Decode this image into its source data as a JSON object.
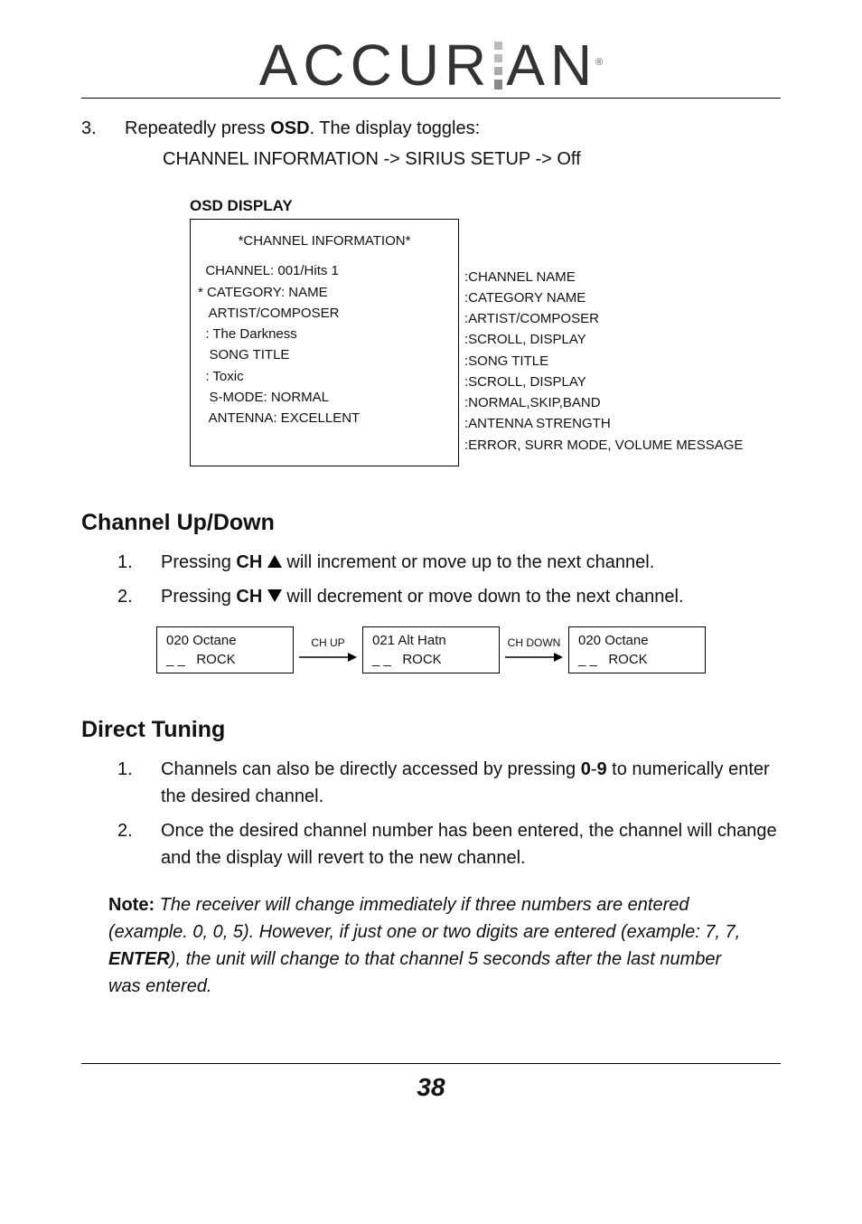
{
  "logo_text_1": "ACCUR",
  "logo_text_2": "AN",
  "logo_reg": "®",
  "step3_num": "3.",
  "step3_text_a": "Repeatedly press ",
  "step3_text_b": "OSD",
  "step3_text_c": ". The display toggles:",
  "step3_sub": "CHANNEL INFORMATION -> SIRIUS SETUP -> Off",
  "osd_label": "OSD DISPLAY",
  "osd_box_title": "*CHANNEL INFORMATION*",
  "osd_lines": [
    "  CHANNEL: 001/Hits 1",
    "* CATEGORY: NAME",
    "   ARTIST/COMPOSER",
    "  : The Darkness",
    "   SONG TITLE",
    "  : Toxic",
    "   S-MODE: NORMAL",
    "   ANTENNA: EXCELLENT"
  ],
  "osd_right": [
    ":CHANNEL NAME",
    ":CATEGORY NAME",
    ":ARTIST/COMPOSER",
    ":SCROLL, DISPLAY",
    ":SONG TITLE",
    ":SCROLL, DISPLAY",
    ":NORMAL,SKIP,BAND",
    ":ANTENNA STRENGTH",
    ":ERROR, SURR MODE, VOLUME MESSAGE"
  ],
  "h_updown": "Channel Up/Down",
  "ud1_num": "1.",
  "ud1_a": "Pressing ",
  "ud1_b": "CH",
  "ud1_c": " will increment or move up to the next channel.",
  "ud2_num": "2.",
  "ud2_a": "Pressing ",
  "ud2_b": "CH",
  "ud2_c": " will decrement or move down to the next channel.",
  "flow1_l1": "020 Octane",
  "flow1_l2": "_ _   ROCK",
  "flow_lbl_up": "CH UP",
  "flow2_l1": "021 Alt Hatn",
  "flow2_l2": "_ _   ROCK",
  "flow_lbl_dn": "CH DOWN",
  "flow3_l1": "020 Octane",
  "flow3_l2": "_ _   ROCK",
  "h_direct": "Direct Tuning",
  "dt1_num": "1.",
  "dt1_a": "Channels can also be directly accessed by pressing ",
  "dt1_b": "0",
  "dt1_dash": "-",
  "dt1_c": "9",
  "dt1_d": " to numerically enter the desired channel.",
  "dt2_num": "2.",
  "dt2_txt": "Once the desired channel number has been entered, the channel will change and the display will revert to the new channel.",
  "note_b": "Note:",
  "note_i1": " The receiver will change immediately if three numbers are entered (example. 0, 0, 5). However, if just one or two digits are entered (example: 7, 7, ",
  "note_enter": "ENTER",
  "note_i2": "), the unit will change to that channel 5 seconds after the last number was entered.",
  "page_number": "38"
}
